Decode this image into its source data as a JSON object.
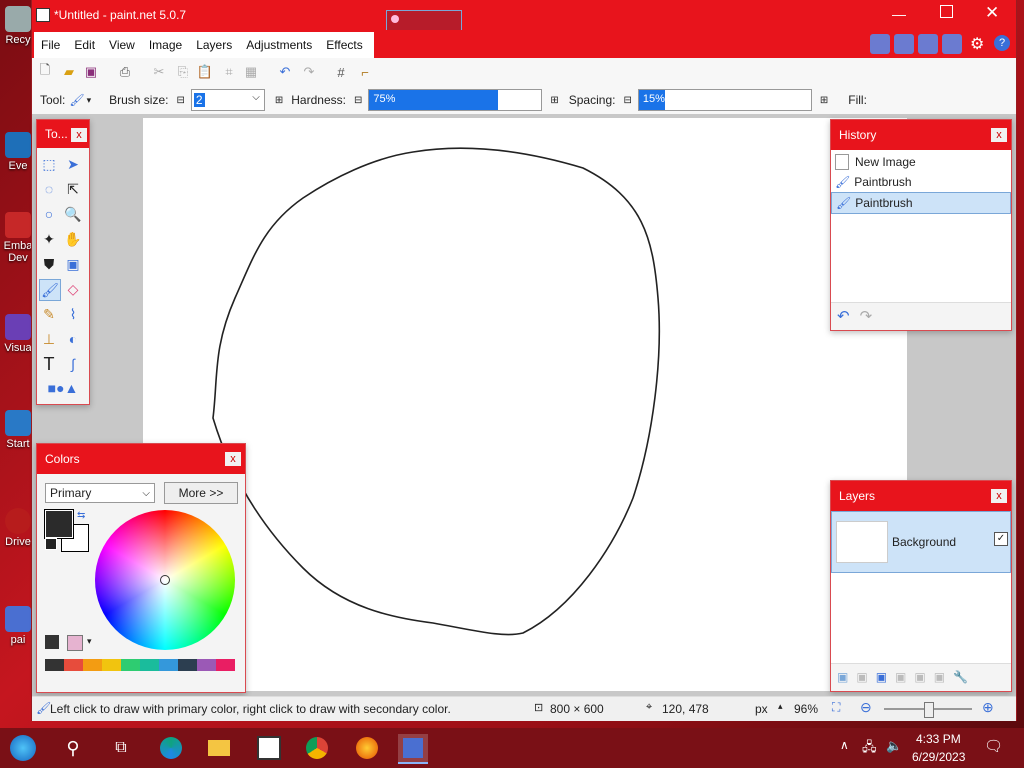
{
  "window": {
    "title": "*Untitled - paint.net 5.0.7"
  },
  "menu": [
    "File",
    "Edit",
    "View",
    "Image",
    "Layers",
    "Adjustments",
    "Effects"
  ],
  "tool_options": {
    "tool_label": "Tool:",
    "brush_size_label": "Brush size:",
    "brush_size_value": "2",
    "hardness_label": "Hardness:",
    "hardness_value": "75%",
    "hardness_fraction": 0.75,
    "spacing_label": "Spacing:",
    "spacing_value": "15%",
    "spacing_fraction": 0.15,
    "fill_label": "Fill:"
  },
  "tools_panel": {
    "title": "To..."
  },
  "history": {
    "title": "History",
    "items": [
      "New Image",
      "Paintbrush",
      "Paintbrush"
    ],
    "selected_index": 2
  },
  "layers": {
    "title": "Layers",
    "items": [
      "Background"
    ]
  },
  "colors": {
    "title": "Colors",
    "mode": "Primary",
    "more_label": "More >>",
    "primary": "#2b2b2b",
    "secondary": "#ffffff",
    "palette": [
      "#333333",
      "#e74c3c",
      "#f39c12",
      "#f1c40f",
      "#2ecc71",
      "#1abc9c",
      "#3498db",
      "#2c3e50",
      "#9b59b6",
      "#e91e63"
    ]
  },
  "status": {
    "hint": "Left click to draw with primary color, right click to draw with secondary color.",
    "size": "800 × 600",
    "cursor": "120, 478",
    "units": "px",
    "zoom": "96%"
  },
  "taskbar": {
    "time": "4:33 PM",
    "date": "6/29/2023"
  },
  "desktop_icons": [
    "Recy",
    "Eve",
    "Emba Dev",
    "Visua",
    "Start",
    "Drive",
    "pai"
  ],
  "accent": "#e8141c"
}
